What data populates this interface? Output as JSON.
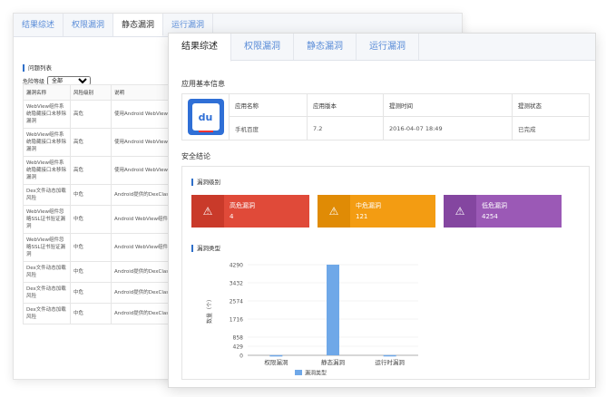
{
  "back_window": {
    "tabs": [
      "结果综述",
      "权限漏洞",
      "静态漏洞",
      "运行漏洞"
    ],
    "active_tab": 2,
    "section_title": "问题列表",
    "filter_label": "危险等级",
    "filter_value": "全部",
    "table_headers": [
      "漏洞名称",
      "风险级别",
      "说明"
    ],
    "rows": [
      {
        "name": "WebView组件系统隐藏接口未移除漏洞",
        "level": "高危",
        "desc": "使用Android WebView组件时，内置的searchBoxJavaBridge_、accessibilityTraversal等会代码任意执行"
      },
      {
        "name": "WebView组件系统隐藏接口未移除漏洞",
        "level": "高危",
        "desc": "使用Android WebView组件时，内置的searchBoxJavaBridge_、accessibilityTraversal等会代码任意执行"
      },
      {
        "name": "WebView组件系统隐藏接口未移除漏洞",
        "level": "高危",
        "desc": "使用Android WebView组件时，内置的searchBoxJavaBridge_、accessibilityTraversal等会代码任意执行"
      },
      {
        "name": "Dex文件动态加载风险",
        "level": "中危",
        "desc": "Android提供的DexClassLoader法，并没有对DEX文件和加载能导致加载文件被优化文件"
      },
      {
        "name": "WebView组件忽略SSL证书验证漏洞",
        "level": "中危",
        "desc": "Android WebView组件加载网onReceivedSslError方法，如果用了handler.proceed()来会受到中间人攻击的威胁"
      },
      {
        "name": "WebView组件忽略SSL证书验证漏洞",
        "level": "中危",
        "desc": "Android WebView组件加载网错误时，会调用WebViewClient用了handler.proceed()来会受到中间人攻击的威胁"
      },
      {
        "name": "Dex文件动态加载风险",
        "level": "中危",
        "desc": "Android提供的DexClassLoader法，并没有对DEX文件和加载能导致加载文件被优化文件"
      },
      {
        "name": "Dex文件动态加载风险",
        "level": "中危",
        "desc": "Android提供的DexClassLoader法，并没有对DEX文件和加载能导致加载文件被优化文件"
      },
      {
        "name": "Dex文件动态加载风险",
        "level": "中危",
        "desc": "Android提供的DexClassLoader法，并没有对DEX文件和加载"
      }
    ]
  },
  "front_window": {
    "tabs": [
      "结果综述",
      "权限漏洞",
      "静态漏洞",
      "运行漏洞"
    ],
    "active_tab": 0,
    "app_info_title": "应用基本信息",
    "app_info": {
      "headers": [
        "应用名称",
        "应用版本",
        "提测时间",
        "提测状态"
      ],
      "values": [
        "手机百度",
        "7.2",
        "2016-04-07 18:49",
        "已完成"
      ],
      "logo_text": "du"
    },
    "safety_title": "安全结论",
    "level_title": "漏洞级别",
    "levels": [
      {
        "label": "高危漏洞",
        "count": "4",
        "color": "#e04a39",
        "icon_bg": "#c93a2a"
      },
      {
        "label": "中危漏洞",
        "count": "121",
        "color": "#f39c12",
        "icon_bg": "#e08b05"
      },
      {
        "label": "低危漏洞",
        "count": "4254",
        "color": "#9b59b6",
        "icon_bg": "#8446a0"
      }
    ],
    "type_title": "漏洞类型"
  },
  "chart_data": {
    "type": "bar",
    "categories": [
      "权限漏洞",
      "静态漏洞",
      "运行时漏洞"
    ],
    "series": [
      {
        "name": "漏洞类型",
        "values": [
          8,
          4290,
          10
        ],
        "color": "#6fa8e8"
      }
    ],
    "ylabel": "数量（个）",
    "yticks": [
      0,
      429,
      858,
      1716,
      2574,
      3432,
      4290
    ],
    "ylim": [
      0,
      4290
    ],
    "legend": "bottom"
  }
}
